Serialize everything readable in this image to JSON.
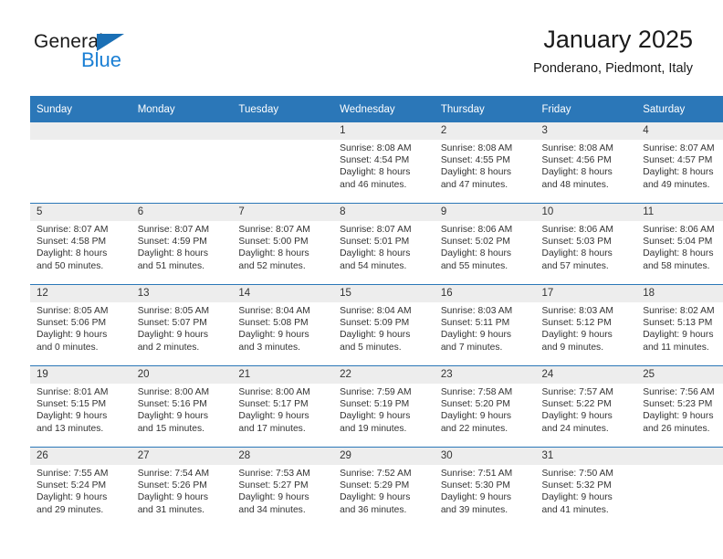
{
  "brand": {
    "name_top": "General",
    "name_bottom": "Blue",
    "accent_color": "#1a7fd4",
    "triangle_color": "#1a6fb5"
  },
  "header": {
    "title": "January 2025",
    "subtitle": "Ponderano, Piedmont, Italy"
  },
  "theme": {
    "header_row_bg": "#2b77b8",
    "header_row_text": "#ffffff",
    "daynum_bg": "#ededed",
    "grid_line": "#2b77b8",
    "body_text": "#333333"
  },
  "calendar": {
    "weekday_headers": [
      "Sunday",
      "Monday",
      "Tuesday",
      "Wednesday",
      "Thursday",
      "Friday",
      "Saturday"
    ],
    "weeks": [
      [
        {
          "day": "",
          "empty": true
        },
        {
          "day": "",
          "empty": true
        },
        {
          "day": "",
          "empty": true
        },
        {
          "day": "1",
          "sunrise": "Sunrise: 8:08 AM",
          "sunset": "Sunset: 4:54 PM",
          "daylight_line1": "Daylight: 8 hours",
          "daylight_line2": "and 46 minutes."
        },
        {
          "day": "2",
          "sunrise": "Sunrise: 8:08 AM",
          "sunset": "Sunset: 4:55 PM",
          "daylight_line1": "Daylight: 8 hours",
          "daylight_line2": "and 47 minutes."
        },
        {
          "day": "3",
          "sunrise": "Sunrise: 8:08 AM",
          "sunset": "Sunset: 4:56 PM",
          "daylight_line1": "Daylight: 8 hours",
          "daylight_line2": "and 48 minutes."
        },
        {
          "day": "4",
          "sunrise": "Sunrise: 8:07 AM",
          "sunset": "Sunset: 4:57 PM",
          "daylight_line1": "Daylight: 8 hours",
          "daylight_line2": "and 49 minutes."
        }
      ],
      [
        {
          "day": "5",
          "sunrise": "Sunrise: 8:07 AM",
          "sunset": "Sunset: 4:58 PM",
          "daylight_line1": "Daylight: 8 hours",
          "daylight_line2": "and 50 minutes."
        },
        {
          "day": "6",
          "sunrise": "Sunrise: 8:07 AM",
          "sunset": "Sunset: 4:59 PM",
          "daylight_line1": "Daylight: 8 hours",
          "daylight_line2": "and 51 minutes."
        },
        {
          "day": "7",
          "sunrise": "Sunrise: 8:07 AM",
          "sunset": "Sunset: 5:00 PM",
          "daylight_line1": "Daylight: 8 hours",
          "daylight_line2": "and 52 minutes."
        },
        {
          "day": "8",
          "sunrise": "Sunrise: 8:07 AM",
          "sunset": "Sunset: 5:01 PM",
          "daylight_line1": "Daylight: 8 hours",
          "daylight_line2": "and 54 minutes."
        },
        {
          "day": "9",
          "sunrise": "Sunrise: 8:06 AM",
          "sunset": "Sunset: 5:02 PM",
          "daylight_line1": "Daylight: 8 hours",
          "daylight_line2": "and 55 minutes."
        },
        {
          "day": "10",
          "sunrise": "Sunrise: 8:06 AM",
          "sunset": "Sunset: 5:03 PM",
          "daylight_line1": "Daylight: 8 hours",
          "daylight_line2": "and 57 minutes."
        },
        {
          "day": "11",
          "sunrise": "Sunrise: 8:06 AM",
          "sunset": "Sunset: 5:04 PM",
          "daylight_line1": "Daylight: 8 hours",
          "daylight_line2": "and 58 minutes."
        }
      ],
      [
        {
          "day": "12",
          "sunrise": "Sunrise: 8:05 AM",
          "sunset": "Sunset: 5:06 PM",
          "daylight_line1": "Daylight: 9 hours",
          "daylight_line2": "and 0 minutes."
        },
        {
          "day": "13",
          "sunrise": "Sunrise: 8:05 AM",
          "sunset": "Sunset: 5:07 PM",
          "daylight_line1": "Daylight: 9 hours",
          "daylight_line2": "and 2 minutes."
        },
        {
          "day": "14",
          "sunrise": "Sunrise: 8:04 AM",
          "sunset": "Sunset: 5:08 PM",
          "daylight_line1": "Daylight: 9 hours",
          "daylight_line2": "and 3 minutes."
        },
        {
          "day": "15",
          "sunrise": "Sunrise: 8:04 AM",
          "sunset": "Sunset: 5:09 PM",
          "daylight_line1": "Daylight: 9 hours",
          "daylight_line2": "and 5 minutes."
        },
        {
          "day": "16",
          "sunrise": "Sunrise: 8:03 AM",
          "sunset": "Sunset: 5:11 PM",
          "daylight_line1": "Daylight: 9 hours",
          "daylight_line2": "and 7 minutes."
        },
        {
          "day": "17",
          "sunrise": "Sunrise: 8:03 AM",
          "sunset": "Sunset: 5:12 PM",
          "daylight_line1": "Daylight: 9 hours",
          "daylight_line2": "and 9 minutes."
        },
        {
          "day": "18",
          "sunrise": "Sunrise: 8:02 AM",
          "sunset": "Sunset: 5:13 PM",
          "daylight_line1": "Daylight: 9 hours",
          "daylight_line2": "and 11 minutes."
        }
      ],
      [
        {
          "day": "19",
          "sunrise": "Sunrise: 8:01 AM",
          "sunset": "Sunset: 5:15 PM",
          "daylight_line1": "Daylight: 9 hours",
          "daylight_line2": "and 13 minutes."
        },
        {
          "day": "20",
          "sunrise": "Sunrise: 8:00 AM",
          "sunset": "Sunset: 5:16 PM",
          "daylight_line1": "Daylight: 9 hours",
          "daylight_line2": "and 15 minutes."
        },
        {
          "day": "21",
          "sunrise": "Sunrise: 8:00 AM",
          "sunset": "Sunset: 5:17 PM",
          "daylight_line1": "Daylight: 9 hours",
          "daylight_line2": "and 17 minutes."
        },
        {
          "day": "22",
          "sunrise": "Sunrise: 7:59 AM",
          "sunset": "Sunset: 5:19 PM",
          "daylight_line1": "Daylight: 9 hours",
          "daylight_line2": "and 19 minutes."
        },
        {
          "day": "23",
          "sunrise": "Sunrise: 7:58 AM",
          "sunset": "Sunset: 5:20 PM",
          "daylight_line1": "Daylight: 9 hours",
          "daylight_line2": "and 22 minutes."
        },
        {
          "day": "24",
          "sunrise": "Sunrise: 7:57 AM",
          "sunset": "Sunset: 5:22 PM",
          "daylight_line1": "Daylight: 9 hours",
          "daylight_line2": "and 24 minutes."
        },
        {
          "day": "25",
          "sunrise": "Sunrise: 7:56 AM",
          "sunset": "Sunset: 5:23 PM",
          "daylight_line1": "Daylight: 9 hours",
          "daylight_line2": "and 26 minutes."
        }
      ],
      [
        {
          "day": "26",
          "sunrise": "Sunrise: 7:55 AM",
          "sunset": "Sunset: 5:24 PM",
          "daylight_line1": "Daylight: 9 hours",
          "daylight_line2": "and 29 minutes."
        },
        {
          "day": "27",
          "sunrise": "Sunrise: 7:54 AM",
          "sunset": "Sunset: 5:26 PM",
          "daylight_line1": "Daylight: 9 hours",
          "daylight_line2": "and 31 minutes."
        },
        {
          "day": "28",
          "sunrise": "Sunrise: 7:53 AM",
          "sunset": "Sunset: 5:27 PM",
          "daylight_line1": "Daylight: 9 hours",
          "daylight_line2": "and 34 minutes."
        },
        {
          "day": "29",
          "sunrise": "Sunrise: 7:52 AM",
          "sunset": "Sunset: 5:29 PM",
          "daylight_line1": "Daylight: 9 hours",
          "daylight_line2": "and 36 minutes."
        },
        {
          "day": "30",
          "sunrise": "Sunrise: 7:51 AM",
          "sunset": "Sunset: 5:30 PM",
          "daylight_line1": "Daylight: 9 hours",
          "daylight_line2": "and 39 minutes."
        },
        {
          "day": "31",
          "sunrise": "Sunrise: 7:50 AM",
          "sunset": "Sunset: 5:32 PM",
          "daylight_line1": "Daylight: 9 hours",
          "daylight_line2": "and 41 minutes."
        },
        {
          "day": "",
          "empty": true
        }
      ]
    ]
  }
}
